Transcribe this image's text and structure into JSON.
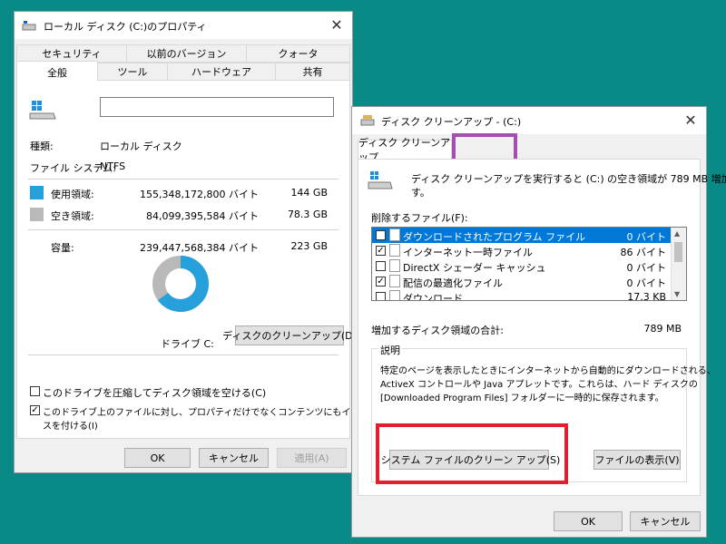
{
  "props": {
    "title": "ローカル ディスク (C:)のプロパティ",
    "tabs_top": [
      "セキュリティ",
      "以前のバージョン",
      "クォータ"
    ],
    "tabs_bottom": [
      "全般",
      "ツール",
      "ハードウェア",
      "共有"
    ],
    "type_label": "種類:",
    "type_value": "ローカル ディスク",
    "fs_label": "ファイル システム:",
    "fs_value": "NTFS",
    "used_label": "使用領域:",
    "used_bytes": "155,348,172,800 バイト",
    "used_gb": "144 GB",
    "free_label": "空き領域:",
    "free_bytes": "84,099,395,584 バイト",
    "free_gb": "78.3 GB",
    "cap_label": "容量:",
    "cap_bytes": "239,447,568,384 バイト",
    "cap_gb": "223 GB",
    "drive_label": "ドライブ C:",
    "cleanup_button": "ディスクのクリーンアップ(D)",
    "compress_label": "このドライブを圧縮してディスク領域を空ける(C)",
    "index_label_1": "このドライブ上のファイルに対し、プロパティだけでなくコンテンツにもインデック",
    "index_label_2": "スを付ける(I)",
    "ok": "OK",
    "cancel": "キャンセル",
    "apply": "適用(A)",
    "used_fraction": 0.649,
    "used_color": "#26a0da",
    "free_color": "#b9b9b9"
  },
  "cleanup": {
    "title": "ディスク クリーンアップ - (C:)",
    "tab": "ディスク クリーンアップ",
    "intro": "ディスク クリーンアップを実行すると (C:) の空き領域が 789 MB 増加しま",
    "intro2": "す。",
    "files_label": "削除するファイル(F):",
    "files": [
      {
        "name": "ダウンロードされたプログラム ファイル",
        "size": "0 バイト",
        "checked": true,
        "selected": true
      },
      {
        "name": "インターネット一時ファイル",
        "size": "86 バイト",
        "checked": true,
        "selected": false
      },
      {
        "name": "DirectX シェーダー キャッシュ",
        "size": "0 バイト",
        "checked": false,
        "selected": false
      },
      {
        "name": "配信の最適化ファイル",
        "size": "0 バイト",
        "checked": true,
        "selected": false
      },
      {
        "name": "ダウンロード",
        "size": "17.3 KB",
        "checked": false,
        "selected": false
      }
    ],
    "total_label": "増加するディスク領域の合計:",
    "total_value": "789 MB",
    "desc_label": "説明",
    "desc_line1": "特定のページを表示したときにインターネットから自動的にダウンロードされる、",
    "desc_line2": "ActiveX コントロールや Java アプレットです。これらは、ハード ディスクの",
    "desc_line3": "[Downloaded Program Files] フォルダーに一時的に保存されます。",
    "sys_button": "システム ファイルのクリーン アップ(S)",
    "view_button": "ファイルの表示(V)",
    "ok": "OK",
    "cancel": "キャンセル",
    "highlight_red": "#e0202a",
    "highlight_purple": "#a44fb0"
  }
}
